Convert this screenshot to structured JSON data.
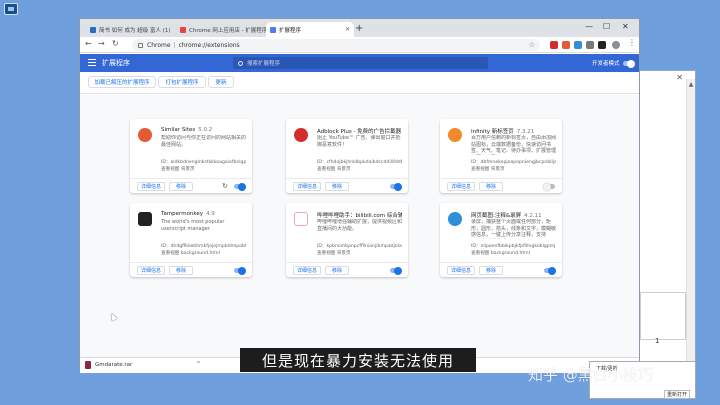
{
  "browser": {
    "tabs": [
      {
        "label": "简书 如何 成为 超级 富人 (1)",
        "fav": "#2d6cc0"
      },
      {
        "label": "Chrome 网上应用店 - 扩展程序",
        "fav": "#e8453c"
      },
      {
        "label": "扩展程序",
        "fav": "#4a80e8"
      }
    ],
    "address": {
      "scheme": "Chrome",
      "url": "chrome://extensions"
    },
    "window": {
      "minimize": "—",
      "maximize": "☐",
      "close": "✕",
      "newtab": "+"
    }
  },
  "extensions_page": {
    "title": "扩展程序",
    "search_placeholder": "搜索扩展程序",
    "dev_mode_label": "开发者模式",
    "dev_mode_on": true,
    "actions": [
      "加载已解压的扩展程序",
      "打包扩展程序",
      "更新"
    ]
  },
  "cards": [
    {
      "name": "Similar Sites",
      "version": "5.0.2",
      "desc": "帮助你访问与你正在访问的网站相关的最佳网站。",
      "id": "ID：aldkbdnenglnksfakkoagaiofbnlgpbhf",
      "views": "查看视图 背景页",
      "details": "详细信息",
      "remove": "移除",
      "enabled": true,
      "reload": true,
      "icon_color": "#e35a35"
    },
    {
      "name": "Adblock Plus - 免费的广告拦截器",
      "version": "3.9",
      "desc": "阻止 YouTube™ 广告、弹出窗口并抵御恶意软件！",
      "id": "ID：cfhdojbkjhnklbpkdaibdccddilifddb",
      "views": "查看视图 背景页",
      "details": "详细信息",
      "remove": "移除",
      "enabled": true,
      "reload": false,
      "icon_color": "#d42d2d"
    },
    {
      "name": "Infinity 新标签页",
      "version": "7.3.21",
      "desc": "百万用户信赖的新标签页，自由添加网站图标，云端数据备份，快速访问书签、天气、笔记、待办事项、扩展管理与历史记录。",
      "id": "ID：dbfmnekepjoapopniengjbcpnblljafg",
      "views": "查看视图 背景页",
      "details": "详细信息",
      "remove": "移除",
      "enabled": false,
      "reload": false,
      "icon_color": "#f08a2c"
    },
    {
      "name": "Tampermonkey",
      "version": "4.9",
      "desc": "The world's most popular userscript manager",
      "id": "ID：dhdgffkkebhmkfjojejmpbldmpobfkfo",
      "views": "查看视图 background.html",
      "details": "详细信息",
      "remove": "移除",
      "enabled": true,
      "reload": false,
      "icon_color": "#222222"
    },
    {
      "name": "哔哩哔哩助手：bilibili.com 综合辅助扩展",
      "version": "1.2.15",
      "desc": "哔哩哔哩增强辅助扩展，提供视频区和直播间的大功能。",
      "id": "ID：kpbnombpnpcffllnianjibmpadjolanh",
      "views": "查看视图 背景页",
      "details": "详细信息",
      "remove": "移除",
      "enabled": true,
      "reload": false,
      "icon_color": "#f3a5b8"
    },
    {
      "name": "网页截图:注释&录屏",
      "version": "4.2.11",
      "desc": "录屏，捕获整个页面或任何部分，矩形，圆形，箭头，线条和文字，模糊敏感信息，一键上传分享注释，支持PNG和其他格式。",
      "id": "ID：nlipoenfbbikpbjkfpfillngkoblgpmj",
      "views": "查看视图 background.html",
      "details": "详细信息",
      "remove": "移除",
      "enabled": true,
      "reload": false,
      "icon_color": "#2f8fd8"
    }
  ],
  "download": {
    "filename": "Gmdarate.rar",
    "chevron": "^",
    "close": "✕"
  },
  "subtitle": "但是现在暴力安装无法使用",
  "watermark": "知乎 @黑白小技巧",
  "popup": {
    "title": "下载/更新",
    "button": "重新打开"
  },
  "background_page": {
    "page_number": "1"
  }
}
